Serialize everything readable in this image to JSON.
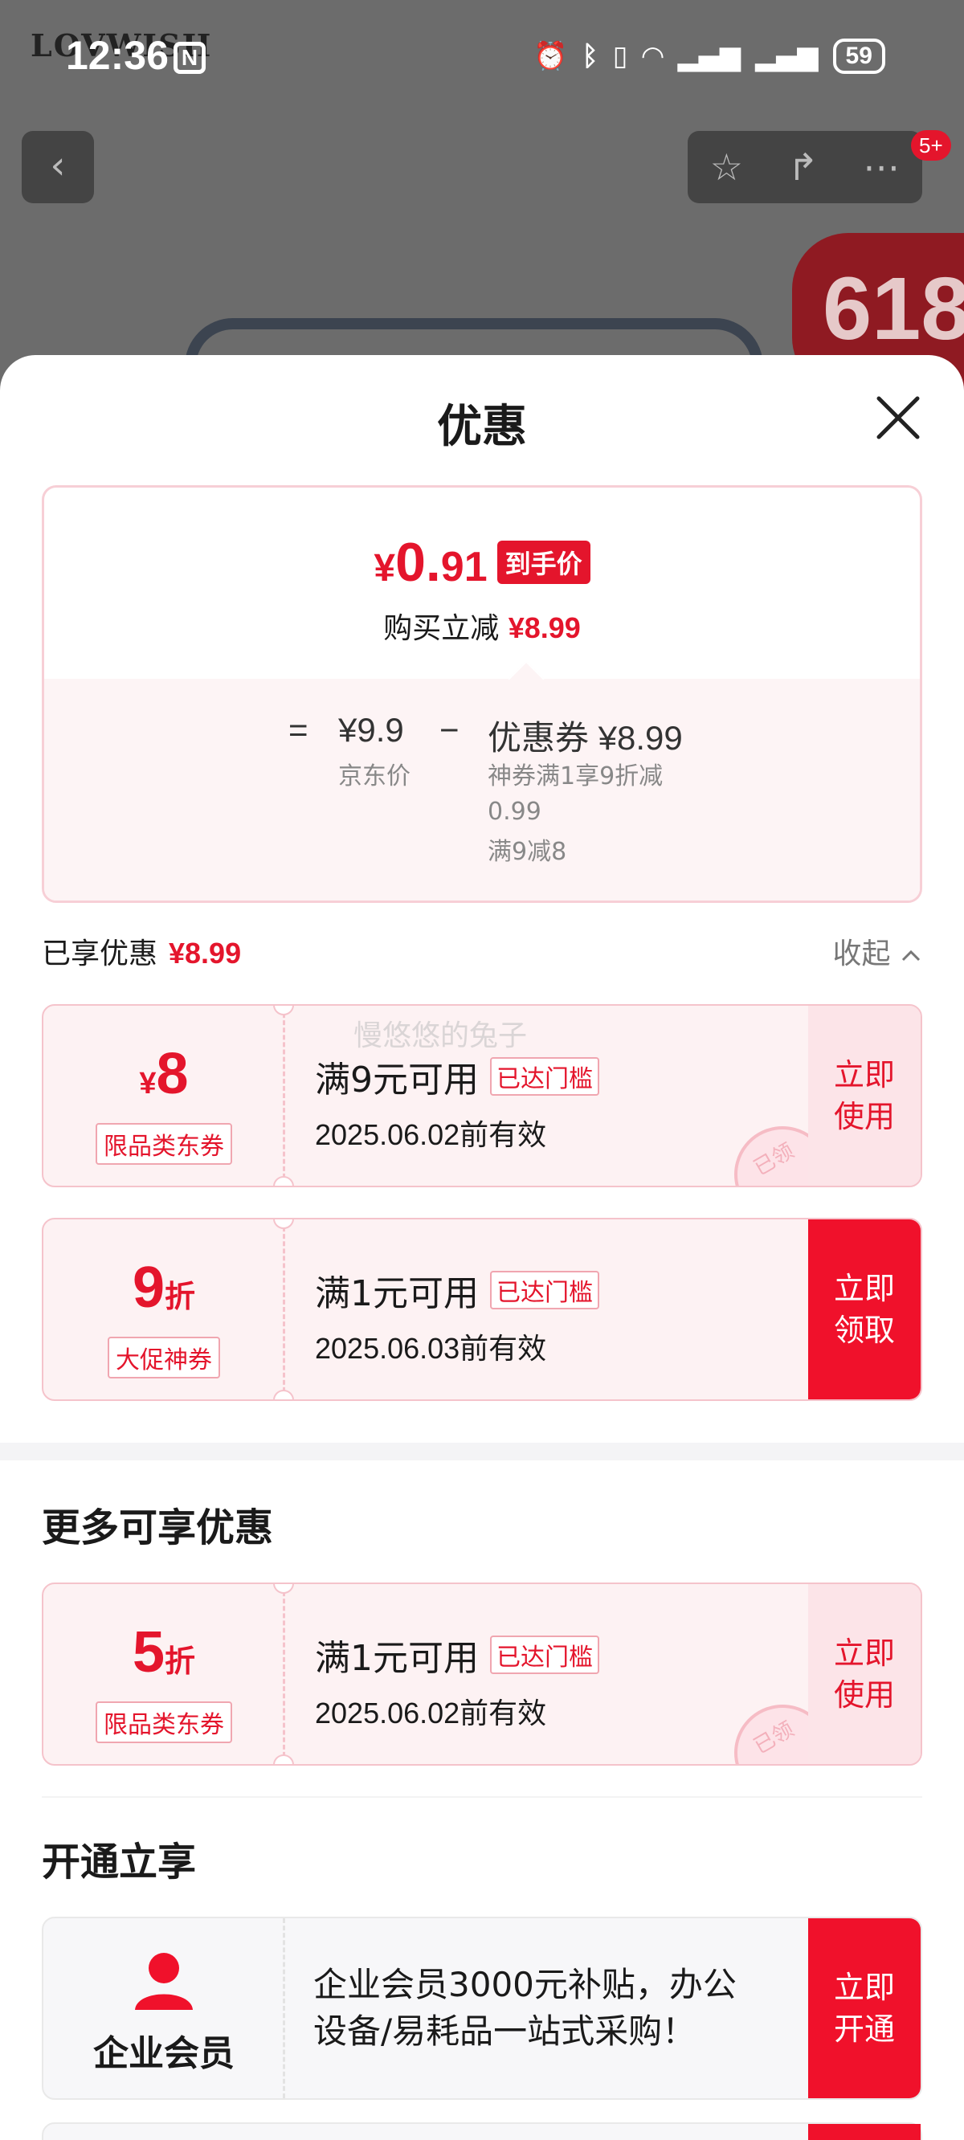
{
  "background": {
    "logo_text": "LOVWISH",
    "status_bar": {
      "time": "12:36",
      "battery": "59",
      "icons": [
        "alarm-icon",
        "bluetooth-icon",
        "vibrate-icon",
        "wifi-icon",
        "5g-signal-icon",
        "5g-signal-icon"
      ]
    },
    "nav": {
      "badge": "5+"
    },
    "promo_badge": "618"
  },
  "sheet": {
    "title": "优惠",
    "price_card": {
      "price_yen": "¥",
      "price_int": "0.",
      "price_dec": "91",
      "price_tag": "到手价",
      "save_label": "购买立减",
      "save_amount": "¥8.99",
      "formula": {
        "equals": "=",
        "jd_price": "¥9.9",
        "jd_price_label": "京东价",
        "minus": "−",
        "coupon_label": "优惠券 ¥8.99",
        "coupon_detail_1": "神券满1享9折减",
        "coupon_detail_2": "0.99",
        "coupon_detail_3": "满9减8"
      }
    },
    "enjoyed": {
      "label": "已享优惠",
      "amount": "¥8.99",
      "collapse": "收起"
    },
    "watermark": "慢悠悠的兔子",
    "coupons": [
      {
        "amount_prefix": "¥",
        "amount": "8",
        "amount_suffix": "",
        "type": "限品类东券",
        "condition": "满9元可用",
        "reached": "已达门槛",
        "valid": "2025.06.02前有效",
        "action_1": "立即",
        "action_2": "使用",
        "stamp": "已领"
      },
      {
        "amount_prefix": "",
        "amount": "9",
        "amount_suffix": "折",
        "type": "大促神券",
        "condition": "满1元可用",
        "reached": "已达门槛",
        "valid": "2025.06.03前有效",
        "action_1": "立即",
        "action_2": "领取"
      }
    ],
    "more": {
      "title": "更多可享优惠",
      "coupon": {
        "amount": "5",
        "amount_suffix": "折",
        "type": "限品类东券",
        "condition": "满1元可用",
        "reached": "已达门槛",
        "valid": "2025.06.02前有效",
        "action_1": "立即",
        "action_2": "使用",
        "stamp": "已领"
      }
    },
    "open": {
      "title": "开通立享",
      "member": {
        "name": "企业会员",
        "desc_1": " 企业会员3000元补贴，办公",
        "desc_2": "设备/易耗品一站式采购！",
        "action_1": "立即",
        "action_2": "开通"
      }
    }
  },
  "colors": {
    "accent": "#e4152c",
    "button_red": "#f0112b",
    "coupon_bg": "#fdf2f3"
  }
}
